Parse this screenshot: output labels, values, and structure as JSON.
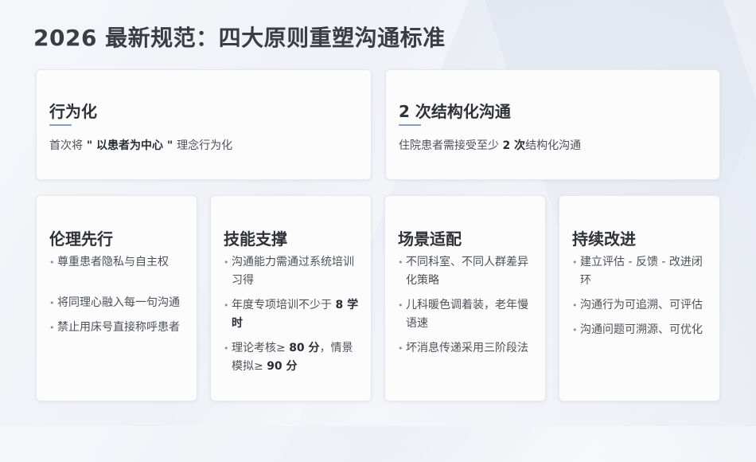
{
  "page": {
    "title": "2026 最新规范：四大原则重塑沟通标准"
  },
  "top_cards": [
    {
      "title": "行为化",
      "desc_pre": "首次将",
      "desc_bold": " \" 以患者为中心 \" ",
      "desc_post": "理念行为化"
    },
    {
      "title": "2 次结构化沟通",
      "desc_pre": "住院患者需接受至少 ",
      "desc_bold": "2 次",
      "desc_post": "结构化沟通"
    }
  ],
  "bottom_cards": [
    {
      "title": "伦理先行",
      "bullets": [
        {
          "text": "尊重患者隐私与自主权"
        },
        {
          "text": "将同理心融入每一句沟通"
        },
        {
          "text": "禁止用床号直接称呼患者"
        }
      ]
    },
    {
      "title": "技能支撑",
      "bullets": [
        {
          "text": "沟通能力需通过系统培训习得"
        },
        {
          "pre": "年度专项培训不少于 ",
          "bold": "8 学时",
          "post": ""
        },
        {
          "pre": "理论考核≥ ",
          "bold": "80 分",
          "mid": "，情景模拟≥ ",
          "bold2": "90 分"
        }
      ]
    },
    {
      "title": "场景适配",
      "bullets": [
        {
          "text": "不同科室、不同人群差异化策略"
        },
        {
          "text": "儿科暖色调着装，老年慢语速"
        },
        {
          "text": "坏消息传递采用三阶段法"
        }
      ]
    },
    {
      "title": "持续改进",
      "bullets": [
        {
          "text": "建立评估 - 反馈 - 改进闭环"
        },
        {
          "text": "沟通行为可追溯、可评估"
        },
        {
          "text": "沟通问题可溯源、可优化"
        }
      ]
    }
  ],
  "colors": {
    "accent_line": "#8ba0c3",
    "title_text": "#3a3d44"
  }
}
